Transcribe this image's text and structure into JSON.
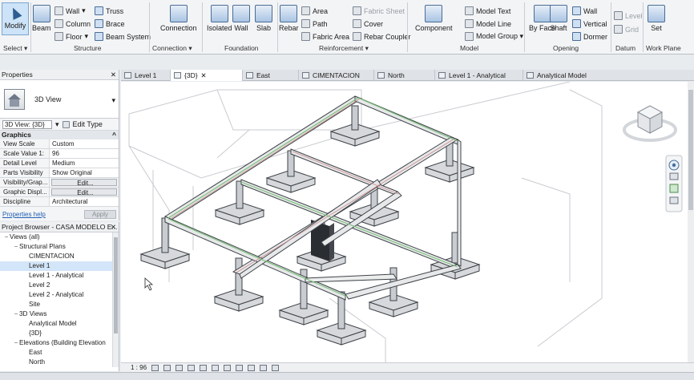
{
  "ribbon": {
    "select": {
      "modify": "Modify",
      "select_label": "Select ▾"
    },
    "structure": {
      "beam": "Beam",
      "wall": "Wall",
      "column": "Column",
      "floor": "Floor",
      "truss": "Truss",
      "brace": "Brace",
      "beam_system": "Beam System",
      "title": "Structure"
    },
    "connection": {
      "connection": "Connection",
      "title": "Connection ▾"
    },
    "foundation": {
      "isolated": "Isolated",
      "wall": "Wall",
      "slab": "Slab",
      "title": "Foundation"
    },
    "reinforcement": {
      "rebar": "Rebar",
      "area": "Area",
      "path": "Path",
      "fabric_area": "Fabric Area",
      "fabric_sheet": "Fabric Sheet",
      "cover": "Cover",
      "rebar_coupler": "Rebar Coupler",
      "title": "Reinforcement ▾"
    },
    "model": {
      "component": "Component",
      "model_text": "Model Text",
      "model_line": "Model Line",
      "model_group": "Model Group ▾",
      "title": "Model"
    },
    "opening": {
      "by_face": "By Face",
      "shaft": "Shaft",
      "wall": "Wall",
      "vertical": "Vertical",
      "dormer": "Dormer",
      "title": "Opening"
    },
    "datum": {
      "level": "Level",
      "grid": "Grid",
      "title": "Datum"
    },
    "work_plane": {
      "set": "Set",
      "title": "Work Plane"
    }
  },
  "properties": {
    "header": "Properties",
    "type_name": "3D View",
    "selector": "3D View: {3D}",
    "edit_type": "Edit Type",
    "group": "Graphics",
    "rows": [
      {
        "k": "View Scale",
        "v": "Custom"
      },
      {
        "k": "Scale Value 1:",
        "v": "96"
      },
      {
        "k": "Detail Level",
        "v": "Medium"
      },
      {
        "k": "Parts Visibility",
        "v": "Show Original"
      },
      {
        "k": "Visibility/Grap...",
        "v": "Edit..."
      },
      {
        "k": "Graphic Displ...",
        "v": "Edit..."
      },
      {
        "k": "Discipline",
        "v": "Architectural"
      }
    ],
    "help": "Properties help",
    "apply": "Apply"
  },
  "browser": {
    "header": "Project Browser - CASA MODELO E...",
    "items": [
      {
        "label": "Views (all)",
        "indent": 0,
        "tog": "−"
      },
      {
        "label": "Structural Plans",
        "indent": 1,
        "tog": "−"
      },
      {
        "label": "CIMENTACION",
        "indent": 2,
        "tog": ""
      },
      {
        "label": "Level 1",
        "indent": 2,
        "tog": ""
      },
      {
        "label": "Level 1 - Analytical",
        "indent": 2,
        "tog": ""
      },
      {
        "label": "Level 2",
        "indent": 2,
        "tog": ""
      },
      {
        "label": "Level 2 - Analytical",
        "indent": 2,
        "tog": ""
      },
      {
        "label": "Site",
        "indent": 2,
        "tog": ""
      },
      {
        "label": "3D Views",
        "indent": 1,
        "tog": "−"
      },
      {
        "label": "Analytical Model",
        "indent": 2,
        "tog": ""
      },
      {
        "label": "{3D}",
        "indent": 2,
        "tog": ""
      },
      {
        "label": "Elevations (Building Elevation",
        "indent": 1,
        "tog": "−"
      },
      {
        "label": "East",
        "indent": 2,
        "tog": ""
      },
      {
        "label": "North",
        "indent": 2,
        "tog": ""
      }
    ]
  },
  "tabs": [
    {
      "label": "Level 1",
      "close": ""
    },
    {
      "label": "{3D}",
      "close": "✕"
    },
    {
      "label": "East",
      "close": ""
    },
    {
      "label": "CIMENTACION",
      "close": ""
    },
    {
      "label": "North",
      "close": ""
    },
    {
      "label": "Level 1 - Analytical",
      "close": ""
    },
    {
      "label": "Analytical Model",
      "close": ""
    }
  ],
  "status": {
    "scale": "1 : 96"
  },
  "colors": {
    "accent": "#cde3f7",
    "beam_line": "#c98a8a",
    "analytical_line": "#7cc07c"
  }
}
